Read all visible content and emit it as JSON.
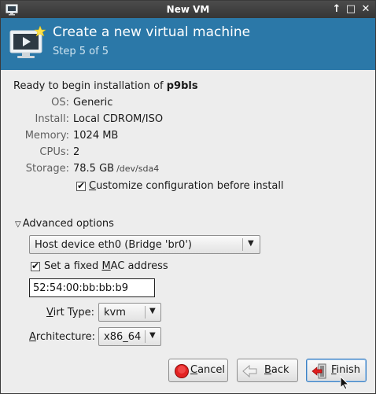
{
  "window": {
    "title": "New VM",
    "buttons": {
      "up": "↑",
      "maximize": "□",
      "close": "✕"
    }
  },
  "header": {
    "heading": "Create a new virtual machine",
    "step": "Step 5 of 5"
  },
  "summary": {
    "ready_prefix": "Ready to begin installation of ",
    "vm_name": "p9bls",
    "rows": [
      {
        "label": "OS:",
        "value": "Generic",
        "sub": ""
      },
      {
        "label": "Install:",
        "value": "Local CDROM/ISO",
        "sub": ""
      },
      {
        "label": "Memory:",
        "value": "1024 MB",
        "sub": ""
      },
      {
        "label": "CPUs:",
        "value": "2",
        "sub": ""
      },
      {
        "label": "Storage:",
        "value": "78.5 GB",
        "sub": "/dev/sda4"
      }
    ],
    "customize": {
      "checked": true,
      "label_pre": "",
      "label_mnemonic": "C",
      "label_post": "ustomize configuration before install"
    }
  },
  "advanced": {
    "expander_label": "Advanced options",
    "network_select": "Host device eth0 (Bridge 'br0')",
    "fixed_mac": {
      "checked": true,
      "label_pre": "Set a fixed ",
      "label_mnemonic": "M",
      "label_post": "AC address"
    },
    "mac_value": "52:54:00:bb:bb:b9",
    "virt_type": {
      "label_pre": "",
      "label_mnemonic": "V",
      "label_post": "irt Type:",
      "value": "kvm"
    },
    "architecture": {
      "label_pre": "",
      "label_mnemonic": "A",
      "label_post": "rchitecture:",
      "value": "x86_64"
    }
  },
  "footer": {
    "cancel": {
      "mnemonic": "C",
      "rest": "ancel"
    },
    "back": {
      "mnemonic": "B",
      "rest": "ack"
    },
    "finish": {
      "mnemonic": "F",
      "rest": "inish"
    }
  },
  "colors": {
    "banner": "#2b78a8",
    "titlebar": "#404040",
    "window_bg": "#ededed"
  }
}
